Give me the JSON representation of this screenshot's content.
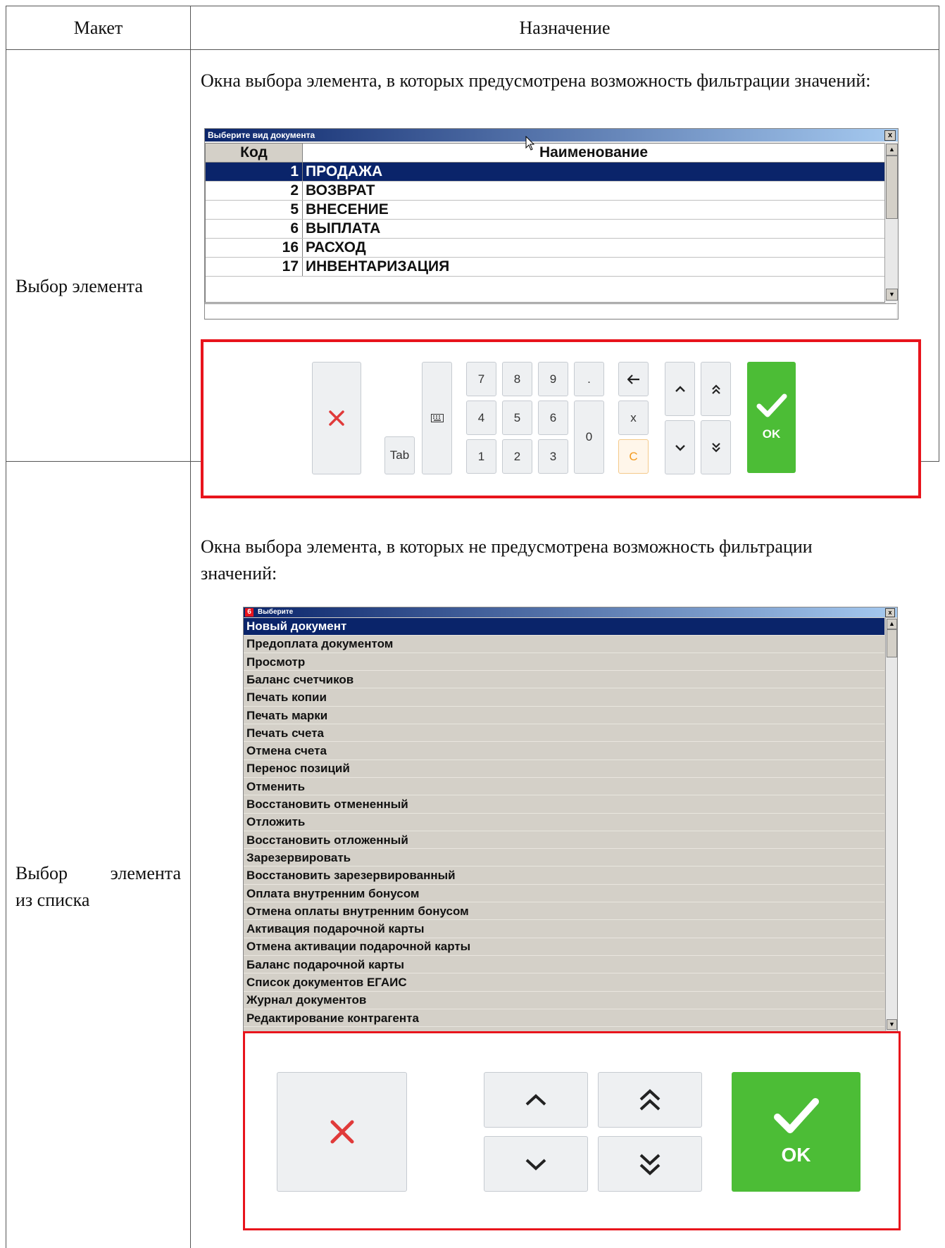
{
  "table": {
    "header_col1": "Макет",
    "header_col2": "Назначение"
  },
  "section1": {
    "label": "Выбор элемента",
    "intro": "Окна выбора элемента, в которых предусмотрена возможность фильтрации значений:",
    "window": {
      "title": "Выберите вид документа",
      "close": "x",
      "col_code": "Код",
      "col_name": "Наименование",
      "rows": [
        {
          "code": "1",
          "name": "ПРОДАЖА",
          "selected": true
        },
        {
          "code": "2",
          "name": "ВОЗВРАТ"
        },
        {
          "code": "5",
          "name": "ВНЕСЕНИЕ"
        },
        {
          "code": "6",
          "name": "ВЫПЛАТА"
        },
        {
          "code": "16",
          "name": "РАСХОД"
        },
        {
          "code": "17",
          "name": "ИНВЕНТАРИЗАЦИЯ"
        }
      ],
      "scroll_up": "▲",
      "scroll_down": "▼"
    },
    "keypad": {
      "tab": "Tab",
      "keyboard_icon": "keyboard-icon",
      "digits": [
        "7",
        "8",
        "9",
        ".",
        "4",
        "5",
        "6",
        "1",
        "2",
        "3",
        "0"
      ],
      "backspace": "🡐",
      "x": "x",
      "clear": "C",
      "ok": "OK",
      "colors": {
        "cancel": "#e03a3a",
        "ok": "#4cbd36",
        "clear": "#f39a1e",
        "frame": "#e8141c"
      }
    }
  },
  "section2": {
    "label_line1": "Выбор элемента",
    "label_line2": "из списка",
    "intro": "Окна выбора элемента, в которых не предусмотрена возможность фильтрации значений:",
    "window": {
      "badge": "6",
      "title": "Выберите",
      "close": "x",
      "items": [
        "Новый документ",
        "Предоплата документом",
        "Просмотр",
        "Баланс счетчиков",
        "Печать копии",
        "Печать марки",
        "Печать счета",
        "Отмена счета",
        "Перенос позиций",
        "Отменить",
        "Восстановить отмененный",
        "Отложить",
        "Восстановить отложенный",
        "Зарезервировать",
        "Восстановить зарезервированный",
        "Оплата внутренним бонусом",
        "Отмена оплаты внутренним бонусом",
        "Активация подарочной карты",
        "Отмена активации подарочной карты",
        "Баланс подарочной карты",
        "Список документов ЕГАИС",
        "Журнал документов",
        "Редактирование контрагента"
      ],
      "selected_index": 0
    },
    "buttons": {
      "ok": "OK"
    }
  }
}
